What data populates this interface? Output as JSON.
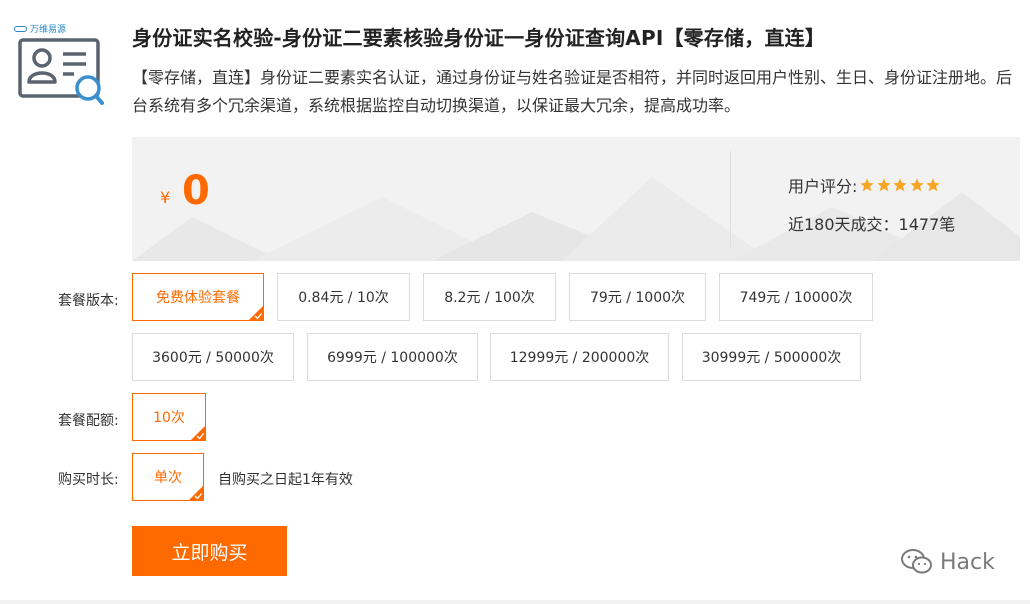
{
  "brand": {
    "logo_text": "万维易源"
  },
  "product": {
    "title": "身份证实名校验-身份证二要素核验身份证一身份证查询API【零存储，直连】",
    "description": "【零存储，直连】身份证二要素实名认证，通过身份证与姓名验证是否相符，并同时返回用户性别、生日、身份证注册地。后台系统有多个冗余渠道，系统根据监控自动切换渠道，以保证最大冗余，提高成功率。"
  },
  "pricing": {
    "currency_symbol": "¥",
    "price": "0",
    "rating_label": "用户评分:",
    "rating_stars": 5,
    "sales_text": "近180天成交：1477笔"
  },
  "packages": {
    "label": "套餐版本:",
    "selected_index": 0,
    "options": [
      "免费体验套餐",
      "0.84元 / 10次",
      "8.2元 / 100次",
      "79元 / 1000次",
      "749元 / 10000次",
      "3600元 / 50000次",
      "6999元 / 100000次",
      "12999元 / 200000次",
      "30999元 / 500000次"
    ]
  },
  "quota": {
    "label": "套餐配额:",
    "options": [
      "10次"
    ],
    "selected_index": 0
  },
  "duration": {
    "label": "购买时长:",
    "options": [
      "单次"
    ],
    "selected_index": 0,
    "note": "自购买之日起1年有效"
  },
  "actions": {
    "buy_label": "立即购买"
  },
  "watermark": {
    "text": "Hack"
  },
  "colors": {
    "accent": "#ff6a00",
    "panel_bg": "#f2f2f2",
    "star": "#f5a623",
    "border": "#dcdcdc"
  }
}
